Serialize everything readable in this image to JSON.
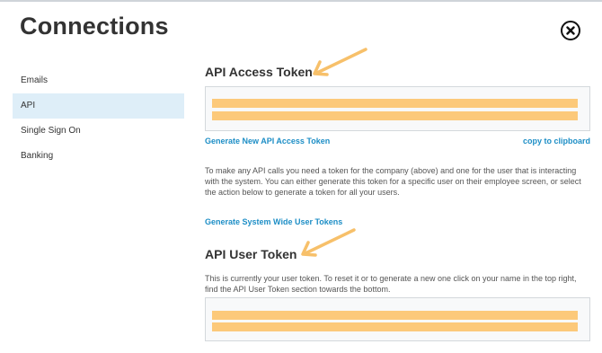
{
  "header": {
    "title": "Connections",
    "close_icon": "close-circle-icon"
  },
  "sidebar": {
    "items": [
      {
        "label": "Emails",
        "active": false
      },
      {
        "label": "API",
        "active": true
      },
      {
        "label": "Single Sign On",
        "active": false
      },
      {
        "label": "Banking",
        "active": false
      }
    ]
  },
  "main": {
    "access_token": {
      "heading": "API Access Token",
      "generate_link": "Generate New API Access Token",
      "copy_link": "copy to clipboard",
      "description": "To make any API calls you need a token for the company (above) and one for the user that is interacting with the system. You can either generate this token for a specific user on their employee screen, or select the action below to generate a token for all your users.",
      "generate_all_link": "Generate System Wide User Tokens"
    },
    "user_token": {
      "heading": "API User Token",
      "description": "This is currently your user token. To reset it or to generate a new one click on your name in the top right, find the API User Token section towards the bottom."
    }
  },
  "colors": {
    "accent_link": "#1d8ec6",
    "active_item": "#deeef8",
    "highlight": "#fcc97a",
    "arrow": "#f7c06a"
  },
  "annotations": {
    "arrow_icon": "annotation-arrow-icon"
  }
}
